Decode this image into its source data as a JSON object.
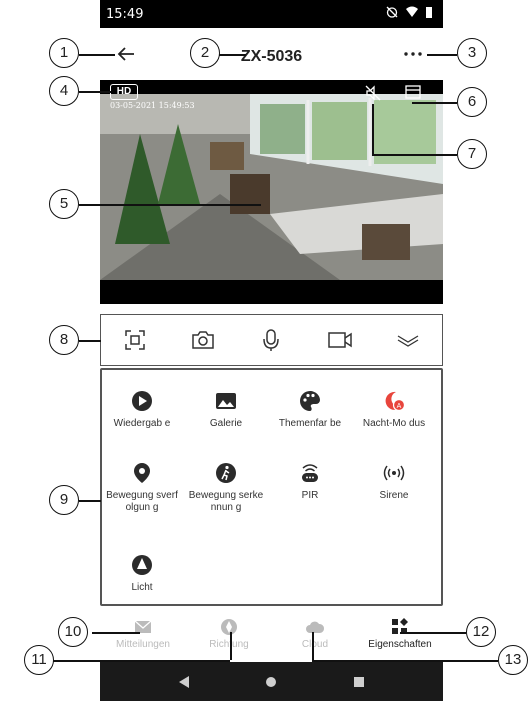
{
  "status_bar": {
    "time": "15:49"
  },
  "app_bar": {
    "title": "ZX-5036"
  },
  "video": {
    "hd_label": "HD",
    "timestamp": "03-05-2021 15:49:53"
  },
  "grid": [
    {
      "label": "Wiedergab e",
      "icon": "play-circle-icon"
    },
    {
      "label": "Galerie",
      "icon": "gallery-icon"
    },
    {
      "label": "Themenfar be",
      "icon": "palette-icon"
    },
    {
      "label": "Nacht-Mo dus",
      "icon": "night-mode-icon"
    },
    {
      "label": "Bewegung sverfolgun g",
      "icon": "location-pin-icon"
    },
    {
      "label": "Bewegung serkennun g",
      "icon": "walking-person-icon"
    },
    {
      "label": "PIR",
      "icon": "pir-sensor-icon"
    },
    {
      "label": "Sirene",
      "icon": "siren-icon"
    },
    {
      "label": "Licht",
      "icon": "light-icon"
    }
  ],
  "bottom_nav": [
    {
      "label": "Mitteilungen",
      "icon": "mail-icon"
    },
    {
      "label": "Richtung",
      "icon": "compass-icon"
    },
    {
      "label": "Cloud",
      "icon": "cloud-icon"
    },
    {
      "label": "Eigenschaften",
      "icon": "properties-icon"
    }
  ],
  "callouts": [
    "1",
    "2",
    "3",
    "4",
    "5",
    "6",
    "7",
    "8",
    "9",
    "10",
    "11",
    "12",
    "13"
  ],
  "colors": {
    "accent": "#e8453c",
    "icon_dark": "#2b2b2b",
    "inactive": "#bbbbbb"
  }
}
